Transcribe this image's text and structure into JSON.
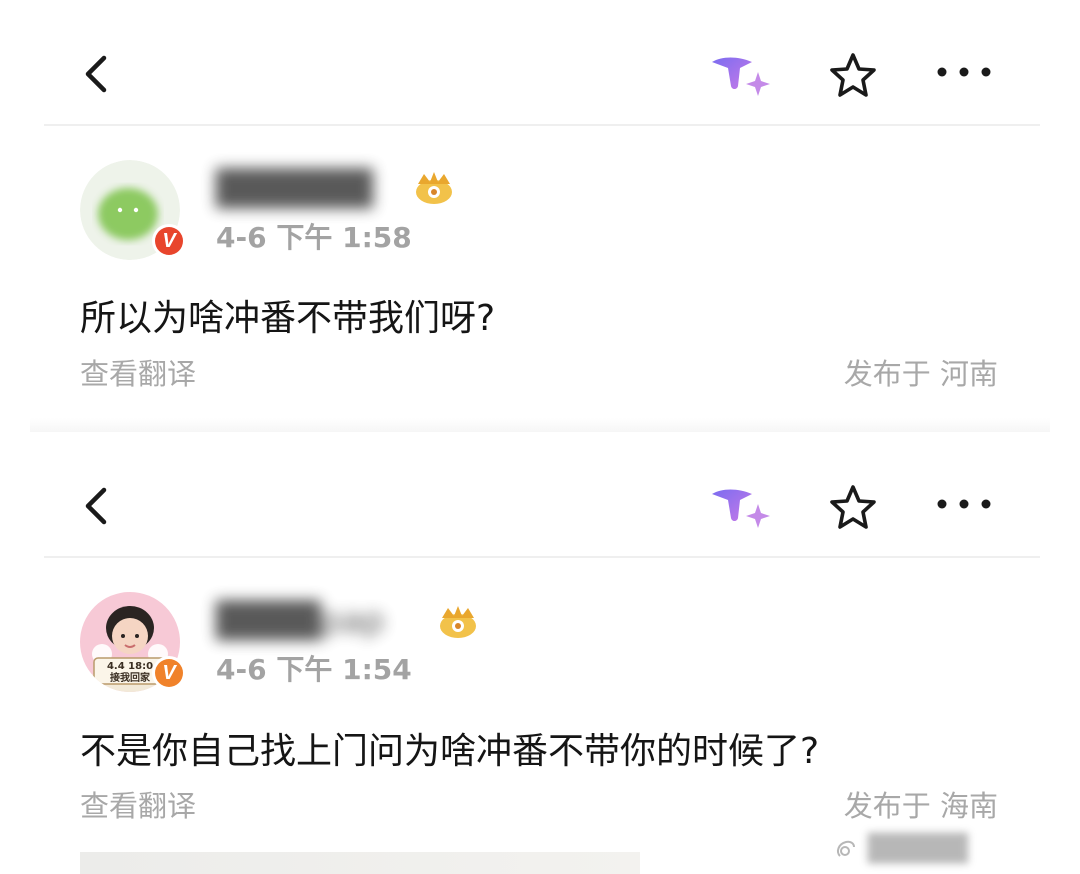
{
  "colors": {
    "accent_purple": "#9a6cf2",
    "verified_red": "#e8452c",
    "verified_orange": "#f0822a",
    "muted_text": "#a8a8a8",
    "body_text": "#151515"
  },
  "icons": {
    "back": "chevron-left-icon",
    "ai_assistant": "ai-sparkle-icon",
    "favorite": "star-outline-icon",
    "more": "more-dots-icon",
    "crown": "crown-badge-icon",
    "verified": "verified-v-icon"
  },
  "posts": [
    {
      "username": "██████",
      "verified_badge": "V",
      "timestamp": "4-6 下午 1:58",
      "text": "所以为啥冲番不带我们呀?",
      "translate_label": "查看翻译",
      "location": "发布于 河南"
    },
    {
      "username": "████pap",
      "verified_badge": "V",
      "avatar_caption_line1": "4.4 18:0",
      "avatar_caption_line2": "接我回家",
      "timestamp": "4-6 下午 1:54",
      "text": "不是你自己找上门问为啥冲番不带你的时候了?",
      "translate_label": "查看翻译",
      "location": "发布于 海南"
    }
  ],
  "watermark": {
    "text": "█████"
  }
}
